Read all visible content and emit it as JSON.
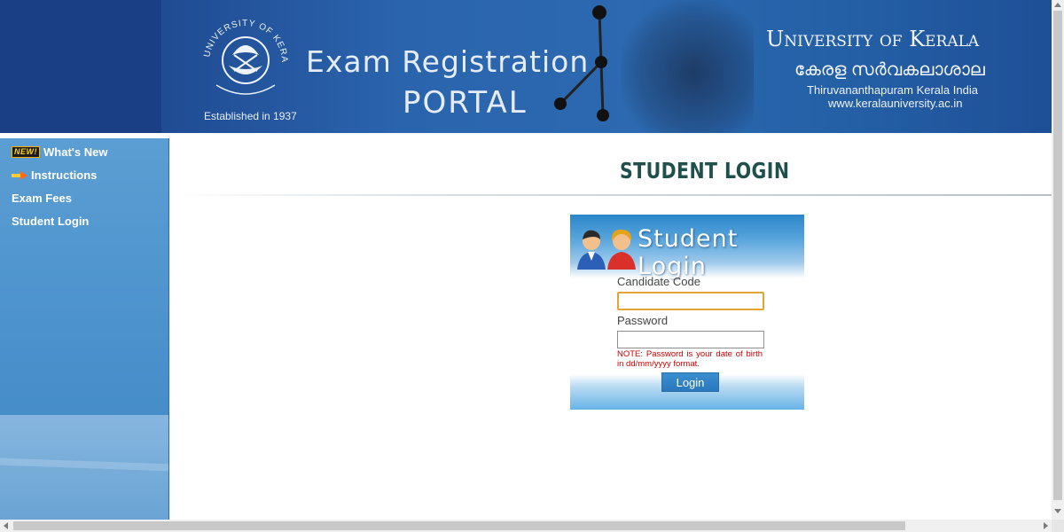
{
  "header": {
    "established": "Established in 1937",
    "title_line1": "Exam Registration",
    "title_line2": "PORTAL",
    "university_name": "University of Kerala",
    "university_malayalam": "കേരള സർവകലാശാല",
    "location": "Thiruvananthapuram  Kerala  India",
    "website": "www.keralauniversity.ac.in"
  },
  "sidebar": {
    "new_badge": "NEW!",
    "items": [
      {
        "label": "What's New"
      },
      {
        "label": "Instructions"
      },
      {
        "label": "Exam Fees"
      },
      {
        "label": "Student Login"
      }
    ]
  },
  "main": {
    "page_title": "STUDENT LOGIN"
  },
  "login": {
    "header_text": "Student  Login",
    "candidate_code_label": "Candidate Code",
    "candidate_code_value": "",
    "password_label": "Password",
    "password_value": "",
    "note": "NOTE: Password is your date of birth in dd/mm/yyyy format.",
    "button_label": "Login"
  },
  "colors": {
    "banner_blue": "#2a64ad",
    "sidebar_blue": "#4a92cb",
    "title_teal": "#20504c",
    "note_red": "#cc0000",
    "button_blue": "#2a78bd",
    "focus_border": "#e7a436"
  },
  "icons": [
    "university-seal-icon",
    "new-badge-icon",
    "arrow-icon",
    "users-icon"
  ]
}
